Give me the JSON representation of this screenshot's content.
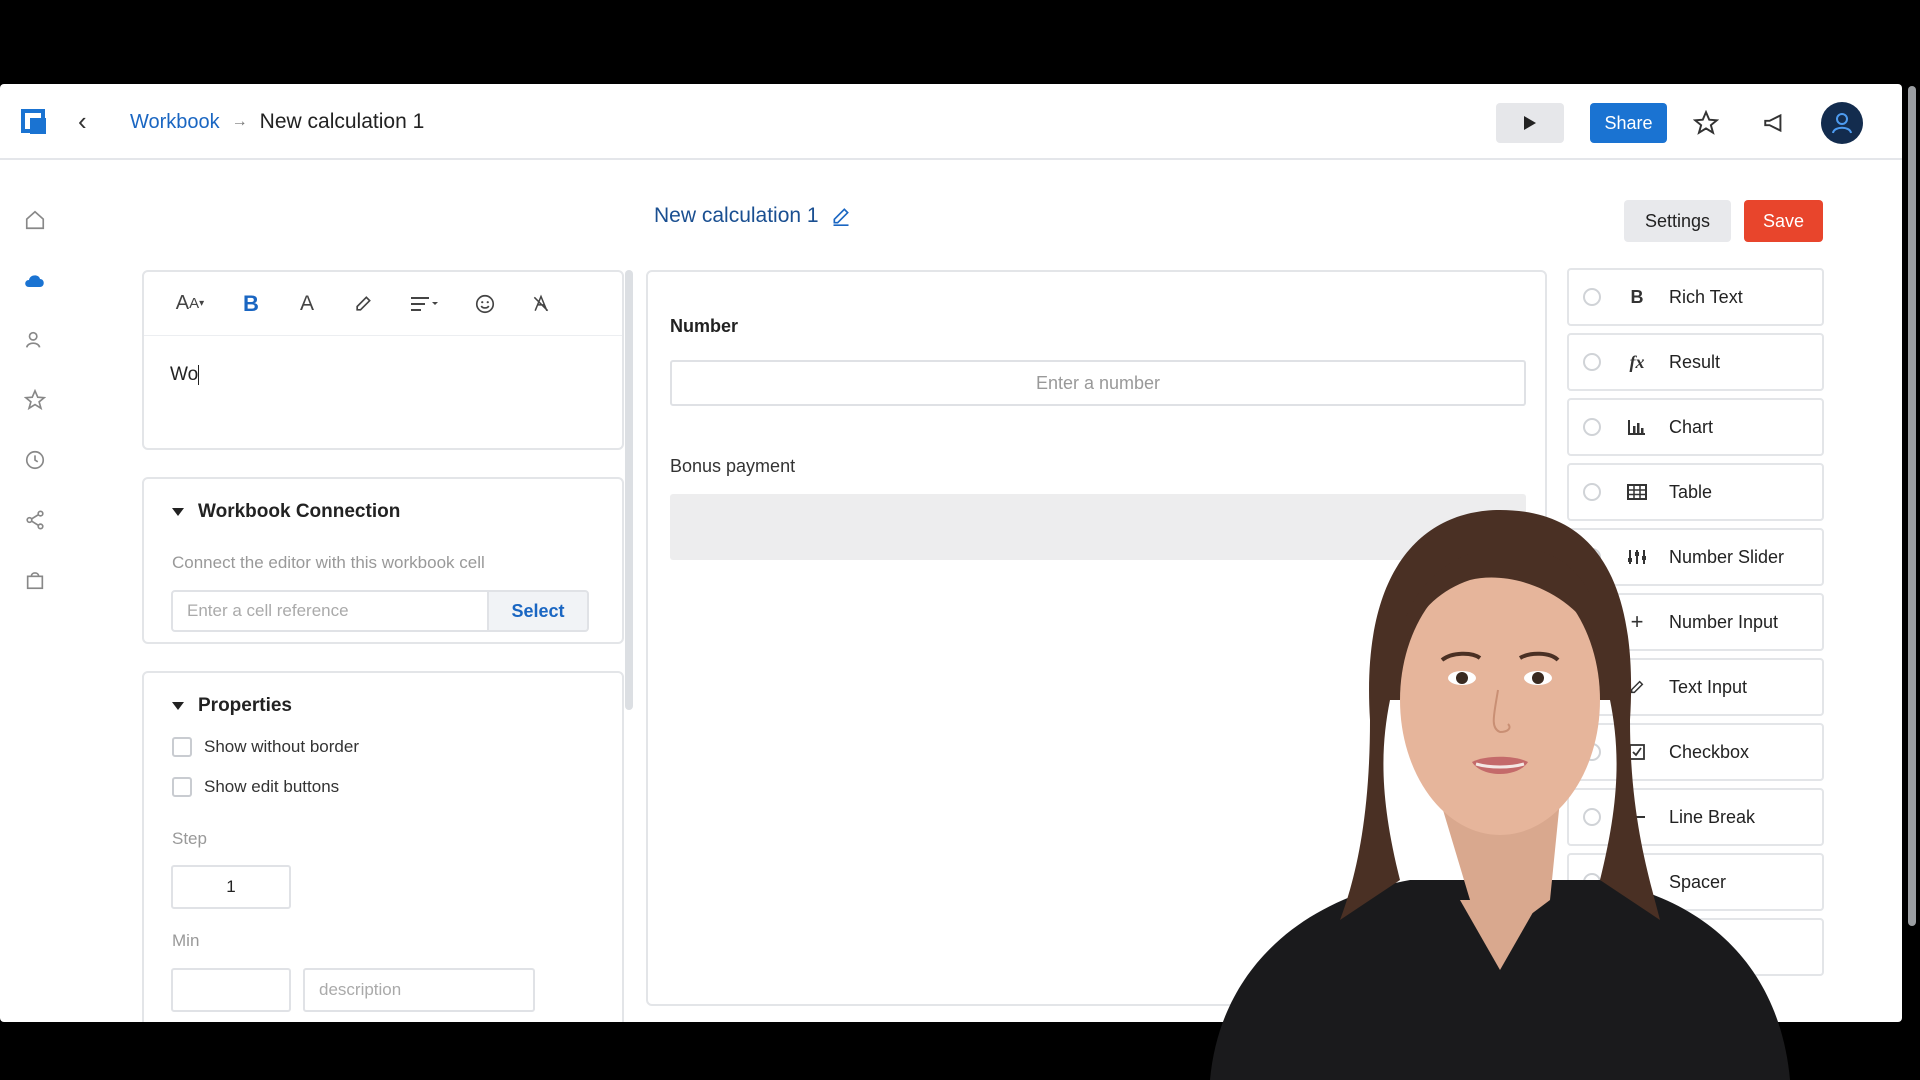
{
  "breadcrumb": {
    "parent": "Workbook",
    "current": "New calculation 1"
  },
  "header": {
    "share_label": "Share"
  },
  "page": {
    "title": "New calculation 1",
    "settings_label": "Settings",
    "save_label": "Save"
  },
  "editor": {
    "text": "Wo"
  },
  "workbook_connection": {
    "title": "Workbook Connection",
    "hint": "Connect the editor with this workbook cell",
    "cell_placeholder": "Enter a cell reference",
    "select_label": "Select"
  },
  "properties": {
    "title": "Properties",
    "show_without_border": "Show without border",
    "show_edit_buttons": "Show edit buttons",
    "step_label": "Step",
    "step_value": "1",
    "min_label": "Min",
    "description_placeholder": "description"
  },
  "canvas": {
    "number_label": "Number",
    "number_placeholder": "Enter a number",
    "bonus_label": "Bonus payment"
  },
  "widgets": [
    {
      "label": "Rich Text",
      "icon": "bold-icon"
    },
    {
      "label": "Result",
      "icon": "function-icon"
    },
    {
      "label": "Chart",
      "icon": "bar-chart-icon"
    },
    {
      "label": "Table",
      "icon": "table-icon"
    },
    {
      "label": "Number Slider",
      "icon": "slider-icon"
    },
    {
      "label": "Number Input",
      "icon": "plus-icon"
    },
    {
      "label": "Text Input",
      "icon": "pencil-icon"
    },
    {
      "label": "Checkbox",
      "icon": "checkbox-icon"
    },
    {
      "label": "Line Break",
      "icon": "line-icon"
    },
    {
      "label": "Spacer",
      "icon": "spacer-icon"
    }
  ],
  "colors": {
    "primary": "#1a73d2",
    "save": "#e8452c",
    "link": "#1a66c2"
  }
}
